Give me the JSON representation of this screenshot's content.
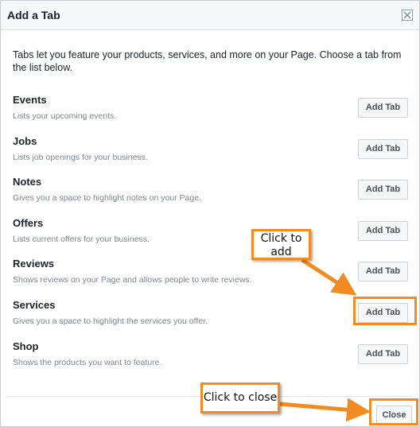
{
  "dialog": {
    "title": "Add a Tab",
    "intro": "Tabs let you feature your products, services, and more on your Page. Choose a tab from the list below."
  },
  "tabs": [
    {
      "name": "Events",
      "description": "Lists your upcoming events.",
      "button": "Add Tab"
    },
    {
      "name": "Jobs",
      "description": "Lists job openings for your business.",
      "button": "Add Tab"
    },
    {
      "name": "Notes",
      "description": "Gives you a space to highlight notes on your Page.",
      "button": "Add Tab"
    },
    {
      "name": "Offers",
      "description": "Lists current offers for your business.",
      "button": "Add Tab"
    },
    {
      "name": "Reviews",
      "description": "Shows reviews on your Page and allows people to write reviews.",
      "button": "Add Tab"
    },
    {
      "name": "Services",
      "description": "Gives you a space to highlight the services you offer.",
      "button": "Add Tab"
    },
    {
      "name": "Shop",
      "description": "Shows the products you want to feature.",
      "button": "Add Tab"
    }
  ],
  "footer": {
    "close_label": "Close"
  },
  "annotations": {
    "add_callout": "Click to add",
    "close_callout": "Click to close",
    "color": "#f28c22"
  },
  "icons": {
    "dialog_close": "close-icon"
  }
}
